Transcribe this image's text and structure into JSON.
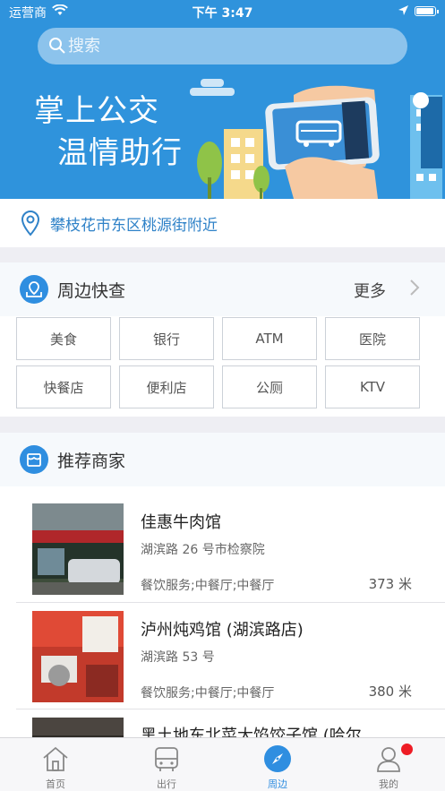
{
  "status_bar": {
    "carrier": "运营商",
    "time": "下午 3:47"
  },
  "search": {
    "placeholder": "搜索"
  },
  "banner": {
    "slogan_line1": "掌上公交",
    "slogan_line2": "温情助行"
  },
  "location": {
    "text": "攀枝花市东区桃源街附近"
  },
  "nearby": {
    "title": "周边快查",
    "more_label": "更多",
    "categories": [
      "美食",
      "银行",
      "ATM",
      "医院",
      "快餐店",
      "便利店",
      "公厕",
      "KTV"
    ]
  },
  "recommend": {
    "title": "推荐商家",
    "merchants": [
      {
        "name": "佳惠牛肉馆",
        "address": "湖滨路 26 号市检察院",
        "category": "餐饮服务;中餐厅;中餐厅",
        "distance": "373 米"
      },
      {
        "name": "泸州炖鸡馆 (湖滨路店)",
        "address": "湖滨路 53 号",
        "category": "餐饮服务;中餐厅;中餐厅",
        "distance": "380 米"
      },
      {
        "name": "黑土地东北菜大馅饺子馆 (哈尔",
        "address": "",
        "category": "",
        "distance": ""
      }
    ]
  },
  "tabbar": {
    "tabs": [
      {
        "label": "首页",
        "icon": "home-icon"
      },
      {
        "label": "出行",
        "icon": "bus-icon"
      },
      {
        "label": "周边",
        "icon": "compass-icon"
      },
      {
        "label": "我的",
        "icon": "user-icon"
      }
    ],
    "active": "周边"
  },
  "colors": {
    "primary": "#2f93dc",
    "accent": "#2f8ee0",
    "badge": "#ee1c25",
    "location_text": "#2f82c8"
  }
}
